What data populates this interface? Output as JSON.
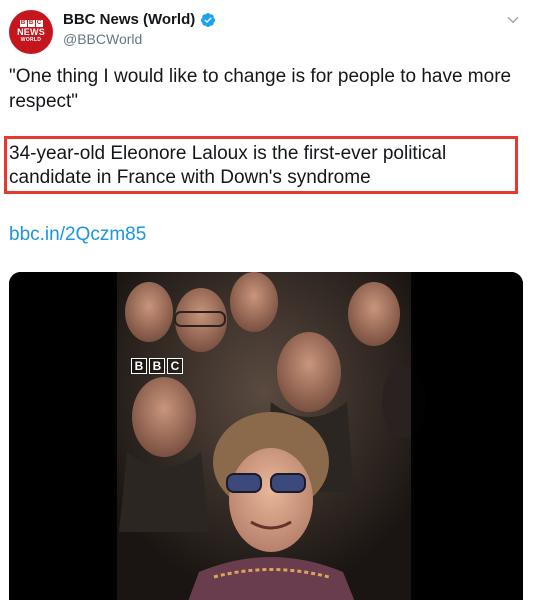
{
  "account": {
    "display_name": "BBC News (World)",
    "handle": "@BBCWorld",
    "verified": true,
    "avatar": {
      "bbc_letters": [
        "B",
        "B",
        "C"
      ],
      "line1": "NEWS",
      "line2": "WORLD"
    }
  },
  "tweet": {
    "quote": "\"One thing I would like to change is for people to have more respect\"",
    "highlighted_text": "34-year-old Eleonore Laloux is the first-ever political candidate in France with Down's syndrome",
    "link": "bbc.in/2Qczm85"
  },
  "video": {
    "watermark_letters": [
      "B",
      "B",
      "C"
    ]
  },
  "colors": {
    "highlight_border": "#e8372e",
    "link": "#1b95e0",
    "verified": "#1da1f2",
    "brand_red": "#c4161c"
  },
  "icons": {
    "verified": "verified-badge-icon",
    "menu": "chevron-down-icon"
  }
}
